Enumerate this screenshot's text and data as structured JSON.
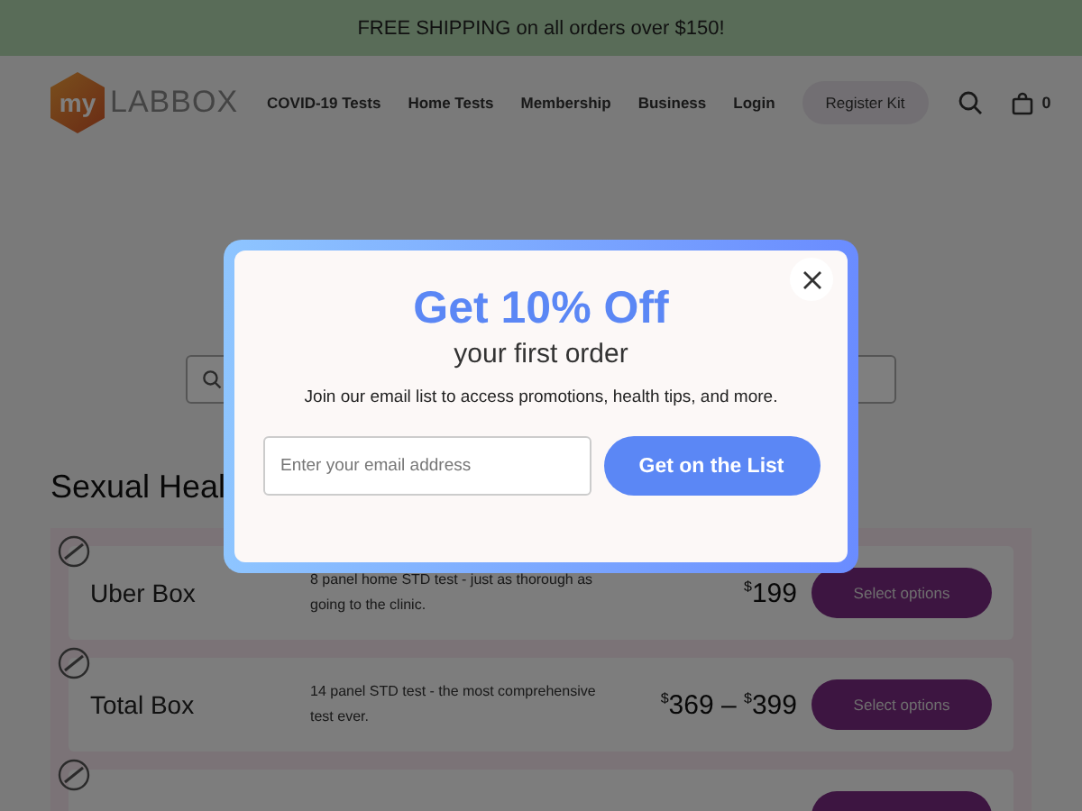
{
  "banner": {
    "text": "FREE SHIPPING on all orders over $150!"
  },
  "header": {
    "logo": {
      "badge": "my",
      "word": "LABBOX"
    },
    "nav": [
      "COVID-19 Tests",
      "Home Tests",
      "Membership",
      "Business",
      "Login"
    ],
    "cta": "Register Kit",
    "cart_count": "0"
  },
  "section": {
    "title": "Sexual Heal",
    "products": [
      {
        "name": "Uber Box",
        "description": "8 panel home STD test - just as thorough as going to the clinic.",
        "prices": [
          {
            "symbol": "$",
            "amount": "199"
          }
        ],
        "button": "Select options"
      },
      {
        "name": "Total Box",
        "description": "14 panel STD test - the most comprehensive test ever.",
        "prices": [
          {
            "symbol": "$",
            "amount": "369"
          },
          {
            "symbol": "$",
            "amount": "399"
          }
        ],
        "separator": "–",
        "button": "Select options"
      }
    ]
  },
  "modal": {
    "title": "Get 10% Off",
    "subtitle": "your first order",
    "text": "Join our email list to access promotions, health tips, and more.",
    "email": {
      "placeholder": "Enter your email address"
    },
    "submit": "Get on the List"
  }
}
